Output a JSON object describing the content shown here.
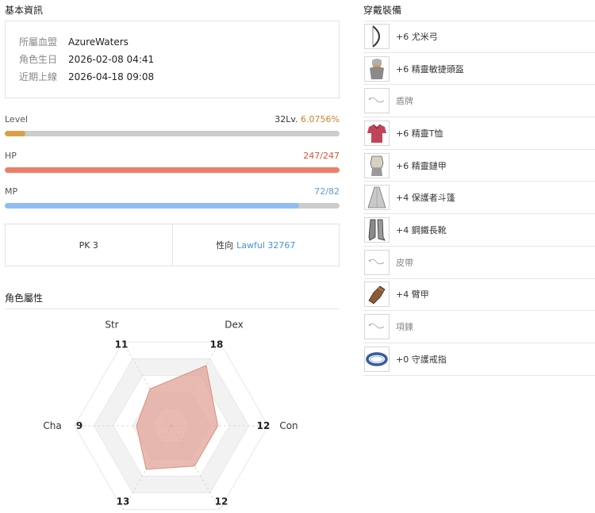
{
  "basic_info": {
    "title": "基本資訊",
    "rows": [
      {
        "label": "所屬血盟",
        "value": "AzureWaters"
      },
      {
        "label": "角色生日",
        "value": "2026-02-08 04:41"
      },
      {
        "label": "近期上線",
        "value": "2026-04-18 09:08"
      }
    ]
  },
  "level": {
    "label": "Level",
    "text": "32Lv.",
    "percent_text": "6.0756%",
    "fraction": 0.060756
  },
  "hp": {
    "label": "HP",
    "text": "247/247",
    "current": 247,
    "max": 247
  },
  "mp": {
    "label": "MP",
    "text": "72/82",
    "current": 72,
    "max": 82
  },
  "pk": {
    "text": "PK 3"
  },
  "alignment": {
    "label": "性向",
    "value": "Lawful 32767"
  },
  "attributes": {
    "title": "角色屬性",
    "stats": [
      {
        "name": "Str",
        "value": 11
      },
      {
        "name": "Dex",
        "value": 18
      },
      {
        "name": "Con",
        "value": 12
      },
      {
        "name": "",
        "value": 12
      },
      {
        "name": "",
        "value": 13
      },
      {
        "name": "Cha",
        "value": 9
      }
    ],
    "max": 25
  },
  "equipment": {
    "title": "穿戴裝備",
    "items": [
      {
        "name": "+6 尤米弓",
        "icon": "bow-icon",
        "empty": false
      },
      {
        "name": "+6 精靈敏捷頭盔",
        "icon": "helmet-icon",
        "empty": false
      },
      {
        "name": "盾牌",
        "icon": "shield-placeholder-icon",
        "empty": true
      },
      {
        "name": "+6 精靈T恤",
        "icon": "tshirt-icon",
        "empty": false
      },
      {
        "name": "+6 精靈鏈甲",
        "icon": "chainmail-icon",
        "empty": false
      },
      {
        "name": "+4 保護者斗篷",
        "icon": "cloak-icon",
        "empty": false
      },
      {
        "name": "+4 鋼鐵長靴",
        "icon": "boots-icon",
        "empty": false
      },
      {
        "name": "皮帶",
        "icon": "belt-placeholder-icon",
        "empty": true
      },
      {
        "name": "+4 臂甲",
        "icon": "gauntlet-icon",
        "empty": false
      },
      {
        "name": "項鍊",
        "icon": "necklace-placeholder-icon",
        "empty": true
      },
      {
        "name": "+0 守護戒指",
        "icon": "ring-icon",
        "empty": false
      }
    ]
  },
  "colors": {
    "level": "#d9a147",
    "level_text": "#c9822a",
    "hp": "#f07d6a",
    "hp_text": "#e0503a",
    "mp": "#8fbdf2",
    "mp_text": "#5a9ce0",
    "radar_fill": "#e2a397"
  }
}
